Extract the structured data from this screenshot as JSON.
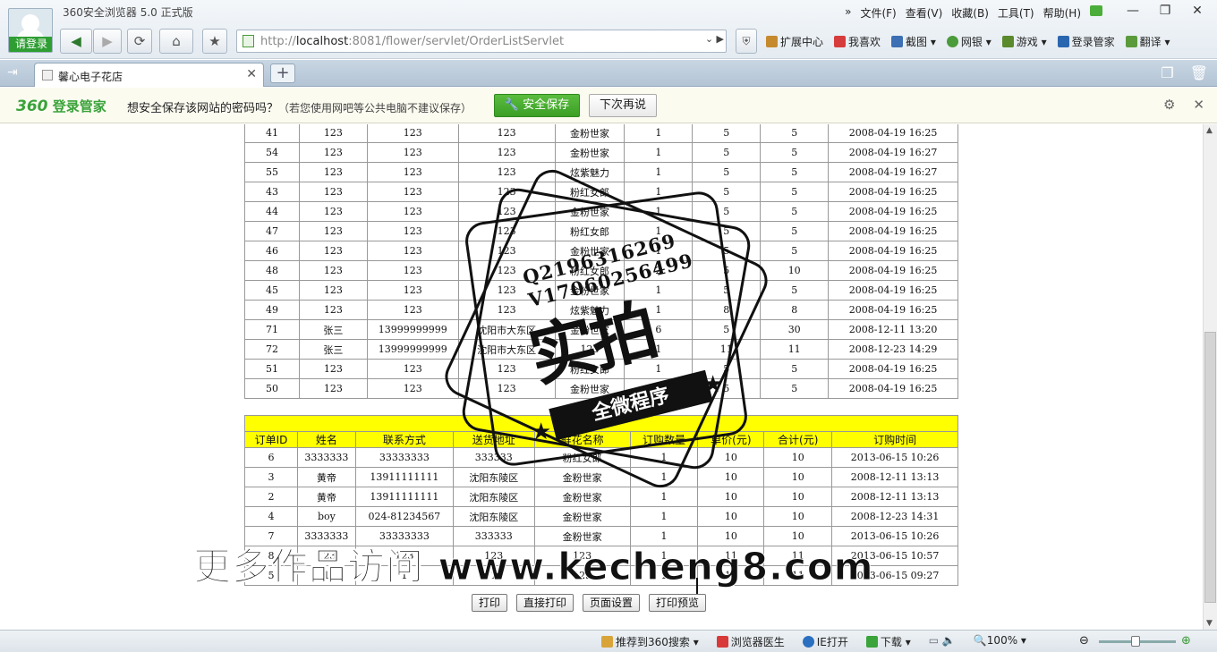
{
  "window": {
    "title": "360安全浏览器 5.0 正式版",
    "login_label": "请登录",
    "menu": [
      "文件(F)",
      "查看(V)",
      "收藏(B)",
      "工具(T)",
      "帮助(H)"
    ],
    "controls": [
      "—",
      "❐",
      "✕"
    ]
  },
  "address_bar": {
    "url_prefix": "http://",
    "url_host": "localhost",
    "url_rest": ":8081/flower/servlet/OrderListServlet"
  },
  "toolbar": {
    "items": [
      "扩展中心",
      "我喜欢",
      "截图",
      "网银",
      "游戏",
      "登录管家",
      "翻译"
    ]
  },
  "tab": {
    "label": "馨心电子花店"
  },
  "password_bar": {
    "brand_num": "360",
    "brand_text": "登录管家",
    "message": "想安全保存该网站的密码吗？",
    "hint": "（若您使用网吧等公共电脑不建议保存）",
    "save_label": "安全保存",
    "later_label": "下次再说"
  },
  "table_top": {
    "rows": [
      [
        "41",
        "123",
        "123",
        "123",
        "金粉世家",
        "1",
        "5",
        "5",
        "2008-04-19 16:25"
      ],
      [
        "54",
        "123",
        "123",
        "123",
        "金粉世家",
        "1",
        "5",
        "5",
        "2008-04-19 16:27"
      ],
      [
        "55",
        "123",
        "123",
        "123",
        "炫紫魅力",
        "1",
        "5",
        "5",
        "2008-04-19 16:27"
      ],
      [
        "43",
        "123",
        "123",
        "123",
        "粉红女郎",
        "1",
        "5",
        "5",
        "2008-04-19 16:25"
      ],
      [
        "44",
        "123",
        "123",
        "123",
        "金粉世家",
        "1",
        "5",
        "5",
        "2008-04-19 16:25"
      ],
      [
        "47",
        "123",
        "123",
        "123",
        "粉红女郎",
        "1",
        "5",
        "5",
        "2008-04-19 16:25"
      ],
      [
        "46",
        "123",
        "123",
        "123",
        "金粉世家",
        "1",
        "5",
        "5",
        "2008-04-19 16:25"
      ],
      [
        "48",
        "123",
        "123",
        "123",
        "粉红女郎",
        "2",
        "5",
        "10",
        "2008-04-19 16:25"
      ],
      [
        "45",
        "123",
        "123",
        "123",
        "金粉世家",
        "1",
        "5",
        "5",
        "2008-04-19 16:25"
      ],
      [
        "49",
        "123",
        "123",
        "123",
        "炫紫魅力",
        "1",
        "8",
        "8",
        "2008-04-19 16:25"
      ],
      [
        "71",
        "张三",
        "13999999999",
        "沈阳市大东区",
        "金粉世家",
        "6",
        "5",
        "30",
        "2008-12-11 13:20"
      ],
      [
        "72",
        "张三",
        "13999999999",
        "沈阳市大东区",
        "123",
        "1",
        "11",
        "11",
        "2008-12-23 14:29"
      ],
      [
        "51",
        "123",
        "123",
        "123",
        "粉红女郎",
        "1",
        "5",
        "5",
        "2008-04-19 16:25"
      ],
      [
        "50",
        "123",
        "123",
        "123",
        "金粉世家",
        "1",
        "5",
        "5",
        "2008-04-19 16:25"
      ]
    ]
  },
  "table_bottom": {
    "headers": [
      "订单ID",
      "姓名",
      "联系方式",
      "送货地址",
      "鲜花名称",
      "订购数量",
      "单价(元)",
      "合计(元)",
      "订购时间"
    ],
    "rows": [
      [
        "6",
        "3333333",
        "33333333",
        "333333",
        "粉红女郎",
        "1",
        "10",
        "10",
        "2013-06-15 10:26"
      ],
      [
        "3",
        "黄帝",
        "13911111111",
        "沈阳东陵区",
        "金粉世家",
        "1",
        "10",
        "10",
        "2008-12-11 13:13"
      ],
      [
        "2",
        "黄帝",
        "13911111111",
        "沈阳东陵区",
        "金粉世家",
        "1",
        "10",
        "10",
        "2008-12-11 13:13"
      ],
      [
        "4",
        "boy",
        "024-81234567",
        "沈阳东陵区",
        "金粉世家",
        "1",
        "10",
        "10",
        "2008-12-23 14:31"
      ],
      [
        "7",
        "3333333",
        "33333333",
        "333333",
        "金粉世家",
        "1",
        "10",
        "10",
        "2013-06-15 10:26"
      ],
      [
        "8",
        "123",
        "123",
        "123",
        "123",
        "1",
        "11",
        "11",
        "2013-06-15 10:57"
      ],
      [
        "5",
        "1",
        "1",
        "1",
        "123",
        "1",
        "11",
        "11",
        "2013-06-15 09:27"
      ]
    ]
  },
  "print_buttons": [
    "打印",
    "直接打印",
    "页面设置",
    "打印预览"
  ],
  "statusbar": {
    "items": [
      "推荐到360搜索",
      "浏览器医生",
      "IE打开",
      "下载"
    ],
    "zoom": "100%"
  },
  "watermark": {
    "qq": "Q2196316269",
    "wechat": "V17060256499",
    "big": "实拍",
    "band": "全微程序",
    "bottom": "更多作品访问 www.kecheng8.com"
  }
}
